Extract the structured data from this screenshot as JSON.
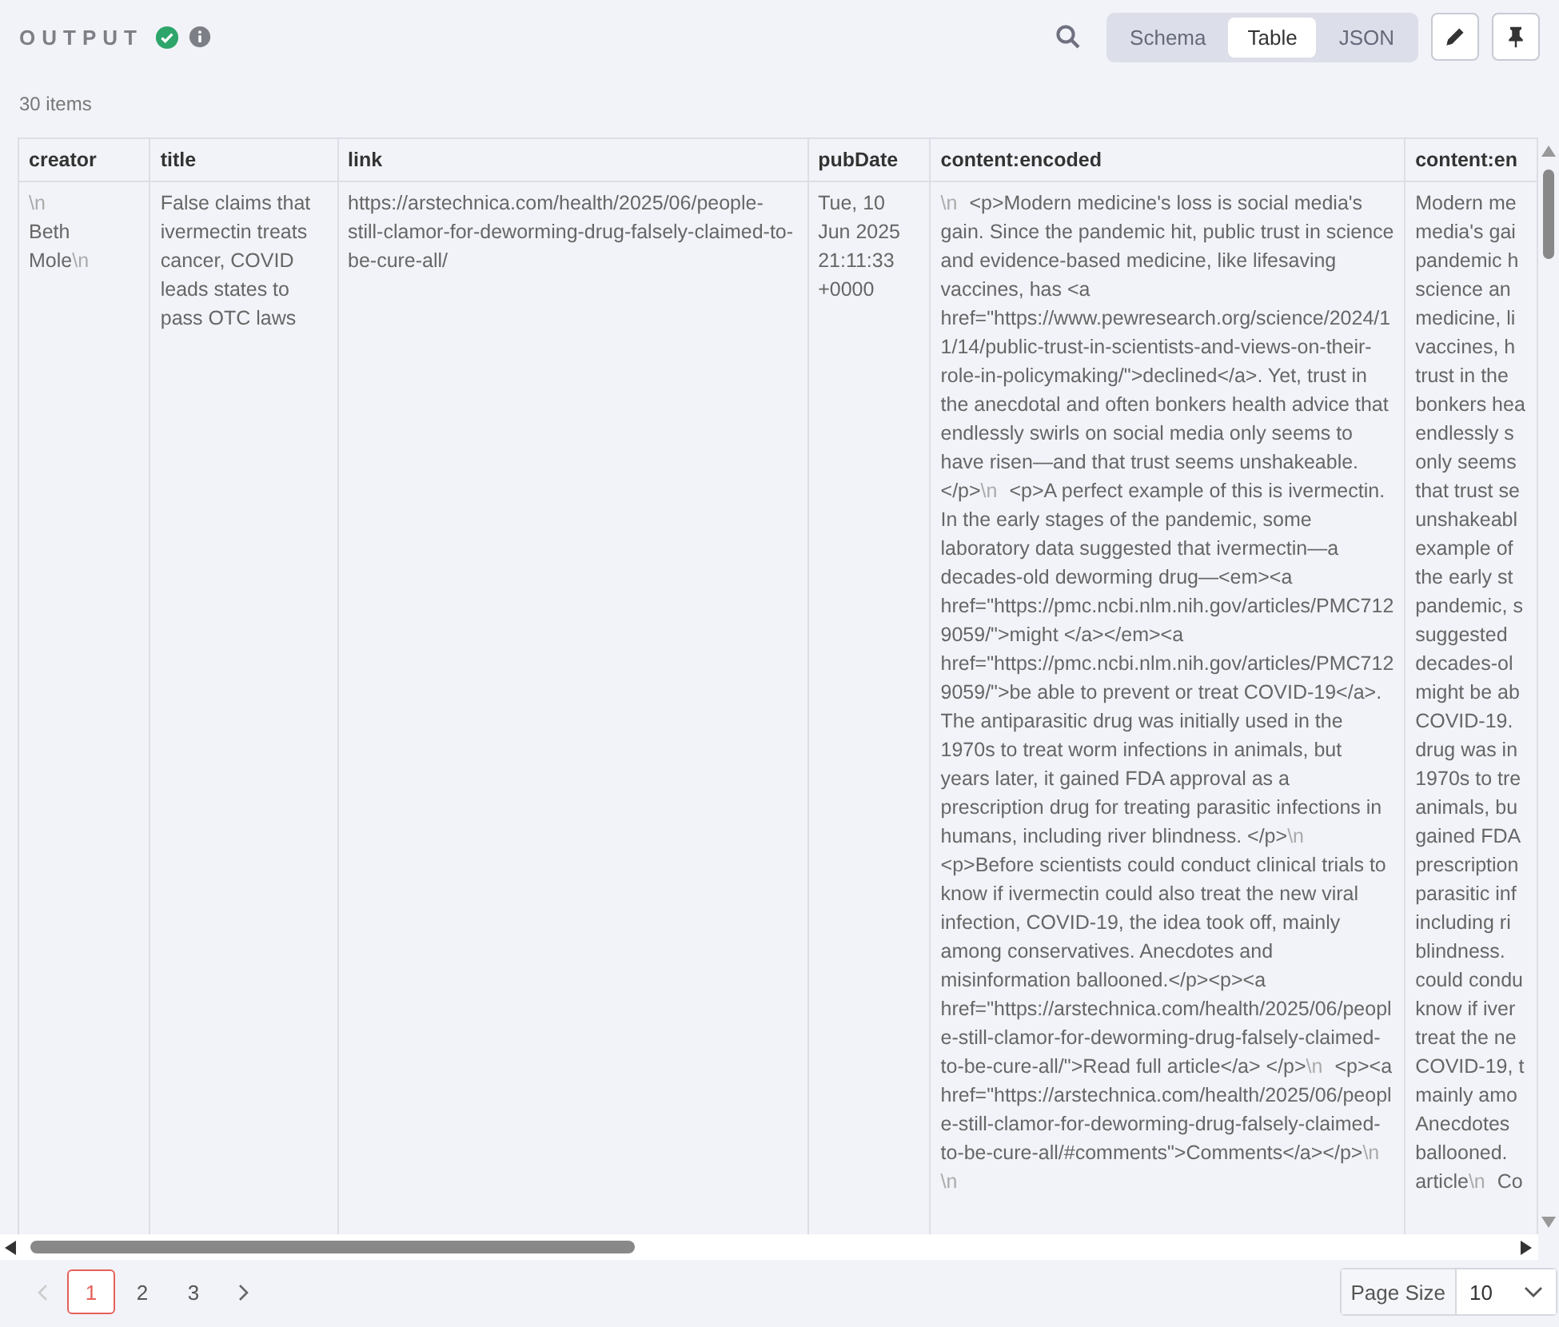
{
  "header": {
    "title": "OUTPUT",
    "views": [
      {
        "label": "Schema",
        "selected": false
      },
      {
        "label": "Table",
        "selected": true
      },
      {
        "label": "JSON",
        "selected": false
      }
    ]
  },
  "item_count": "30 items",
  "table": {
    "columns": [
      "creator",
      "title",
      "link",
      "pubDate",
      "content:encoded",
      "content:en"
    ],
    "rows": [
      {
        "cells": [
          {
            "parts": [
              {
                "kind": "newline_break",
                "text": "\\n"
              },
              {
                "kind": "text",
                "text": "Beth Mole"
              },
              {
                "kind": "newline",
                "text": "\\n"
              }
            ]
          },
          {
            "parts": [
              {
                "kind": "text",
                "text": "False claims that ivermectin treats cancer, COVID leads states to pass OTC laws"
              }
            ]
          },
          {
            "parts": [
              {
                "kind": "text",
                "text": "https://arstechnica.com/health/2025/06/people-still-clamor-for-deworming-drug-falsely-claimed-to-be-cure-all/"
              }
            ]
          },
          {
            "parts": [
              {
                "kind": "text",
                "text": "Tue, 10 Jun 2025 21:11:33 +0000"
              }
            ]
          },
          {
            "parts": [
              {
                "kind": "newline",
                "text": "\\n"
              },
              {
                "kind": "text",
                "text": "<p>Modern medicine's loss is social media's gain. Since the pandemic hit, public trust in science and evidence-based medicine, like lifesaving vaccines, has <a href=\"https://www.pewresearch.org/science/2024/11/14/public-trust-in-scientists-and-views-on-their-role-in-policymaking/\">declined</a>. Yet, trust in the anecdotal and often bonkers health advice that endlessly swirls on social media only seems to have risen—and that trust seems unshakeable.</p>"
              },
              {
                "kind": "newline",
                "text": "\\n"
              },
              {
                "kind": "text",
                "text": "<p>A perfect example of this is ivermectin. In the early stages of the pandemic, some laboratory data suggested that ivermectin—a decades-old deworming drug—<em><a href=\"https://pmc.ncbi.nlm.nih.gov/articles/PMC7129059/\">might </a></em><a href=\"https://pmc.ncbi.nlm.nih.gov/articles/PMC7129059/\">be able to prevent or treat COVID-19</a>. The antiparasitic drug was initially used in the 1970s to treat worm infections in animals, but years later, it gained FDA approval as a prescription drug for treating parasitic infections in humans, including river blindness. </p>"
              },
              {
                "kind": "newline",
                "text": "\\n"
              },
              {
                "kind": "text",
                "text": "<p>Before scientists could conduct clinical trials to know if ivermectin could also treat the new viral infection, COVID-19, the idea took off, mainly among conservatives. Anecdotes and misinformation ballooned.</p><p><a href=\"https://arstechnica.com/health/2025/06/people-still-clamor-for-deworming-drug-falsely-claimed-to-be-cure-all/\">Read full article</a> </p>"
              },
              {
                "kind": "newline",
                "text": "\\n"
              },
              {
                "kind": "text",
                "text": "<p><a href=\"https://arstechnica.com/health/2025/06/people-still-clamor-for-deworming-drug-falsely-claimed-to-be-cure-all/#comments\">Comments</a></p>"
              },
              {
                "kind": "newline",
                "text": "\\n"
              },
              {
                "kind": "newline",
                "text": "\\n"
              }
            ]
          },
          {
            "lines": [
              [
                {
                  "kind": "text",
                  "text": "Modern me"
                }
              ],
              [
                {
                  "kind": "text",
                  "text": "media's gai"
                }
              ],
              [
                {
                  "kind": "text",
                  "text": "pandemic h"
                }
              ],
              [
                {
                  "kind": "text",
                  "text": "science an"
                }
              ],
              [
                {
                  "kind": "text",
                  "text": "medicine, li"
                }
              ],
              [
                {
                  "kind": "text",
                  "text": "vaccines, h"
                }
              ],
              [
                {
                  "kind": "text",
                  "text": "trust in the"
                }
              ],
              [
                {
                  "kind": "text",
                  "text": "bonkers hea"
                }
              ],
              [
                {
                  "kind": "text",
                  "text": "endlessly s"
                }
              ],
              [
                {
                  "kind": "text",
                  "text": "only seems"
                }
              ],
              [
                {
                  "kind": "text",
                  "text": "that trust se"
                }
              ],
              [
                {
                  "kind": "text",
                  "text": "unshakeabl"
                }
              ],
              [
                {
                  "kind": "text",
                  "text": "example of"
                }
              ],
              [
                {
                  "kind": "text",
                  "text": "the early st"
                }
              ],
              [
                {
                  "kind": "text",
                  "text": "pandemic, s"
                }
              ],
              [
                {
                  "kind": "text",
                  "text": "suggested"
                }
              ],
              [
                {
                  "kind": "text",
                  "text": "decades-ol"
                }
              ],
              [
                {
                  "kind": "text",
                  "text": "might be ab"
                }
              ],
              [
                {
                  "kind": "text",
                  "text": "COVID-19."
                }
              ],
              [
                {
                  "kind": "text",
                  "text": "drug was in"
                }
              ],
              [
                {
                  "kind": "text",
                  "text": "1970s to tre"
                }
              ],
              [
                {
                  "kind": "text",
                  "text": "animals, bu"
                }
              ],
              [
                {
                  "kind": "text",
                  "text": "gained FDA"
                }
              ],
              [
                {
                  "kind": "text",
                  "text": "prescription"
                }
              ],
              [
                {
                  "kind": "text",
                  "text": "parasitic inf"
                }
              ],
              [
                {
                  "kind": "text",
                  "text": "including ri"
                }
              ],
              [
                {
                  "kind": "text",
                  "text": "blindness."
                }
              ],
              [
                {
                  "kind": "text",
                  "text": "could condu"
                }
              ],
              [
                {
                  "kind": "text",
                  "text": "know if iver"
                }
              ],
              [
                {
                  "kind": "text",
                  "text": "treat the ne"
                }
              ],
              [
                {
                  "kind": "text",
                  "text": "COVID-19, t"
                }
              ],
              [
                {
                  "kind": "text",
                  "text": "mainly amo"
                }
              ],
              [
                {
                  "kind": "text",
                  "text": "Anecdotes"
                }
              ],
              [
                {
                  "kind": "text",
                  "text": "ballooned."
                }
              ],
              [
                {
                  "kind": "text",
                  "text": "article"
                },
                {
                  "kind": "newline",
                  "text": "\\n"
                },
                {
                  "kind": "text",
                  "text": "Co"
                }
              ]
            ]
          }
        ]
      }
    ]
  },
  "pagination": {
    "previous": {
      "disabled": true
    },
    "pages": [
      {
        "label": "1",
        "selected": true
      },
      {
        "label": "2",
        "selected": false
      },
      {
        "label": "3",
        "selected": false
      }
    ],
    "next": {
      "disabled": false
    },
    "page_size": {
      "label": "Page Size",
      "value": "10"
    }
  }
}
